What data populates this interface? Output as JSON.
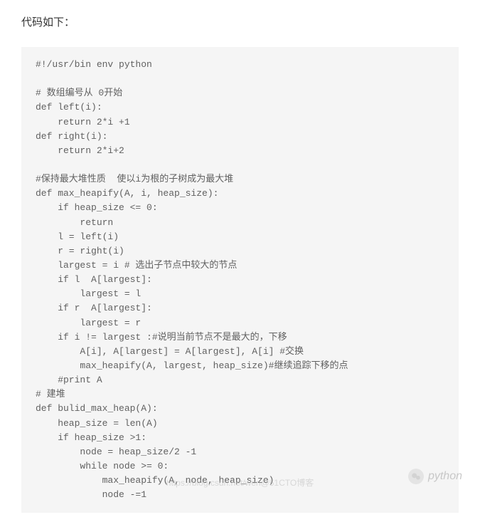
{
  "heading": "代码如下：",
  "code": "#!/usr/bin env python\n\n# 数组编号从 0开始\ndef left(i):\n    return 2*i +1\ndef right(i):\n    return 2*i+2\n\n#保持最大堆性质  使以i为根的子树成为最大堆\ndef max_heapify(A, i, heap_size):\n    if heap_size <= 0:\n        return\n    l = left(i)\n    r = right(i)\n    largest = i # 选出子节点中较大的节点\n    if l  A[largest]:\n        largest = l\n    if r  A[largest]:\n        largest = r\n    if i != largest :#说明当前节点不是最大的，下移\n        A[i], A[largest] = A[largest], A[i] #交换\n        max_heapify(A, largest, heap_size)#继续追踪下移的点\n    #print A\n# 建堆\ndef bulid_max_heap(A):\n    heap_size = len(A)\n    if heap_size >1:\n        node = heap_size/2 -1\n        while node >= 0:\n            max_heapify(A, node, heap_size)\n            node -=1",
  "watermark": {
    "right_text": "python",
    "center_text": "https://blog.csdn.net/wen@51CTO博客"
  }
}
